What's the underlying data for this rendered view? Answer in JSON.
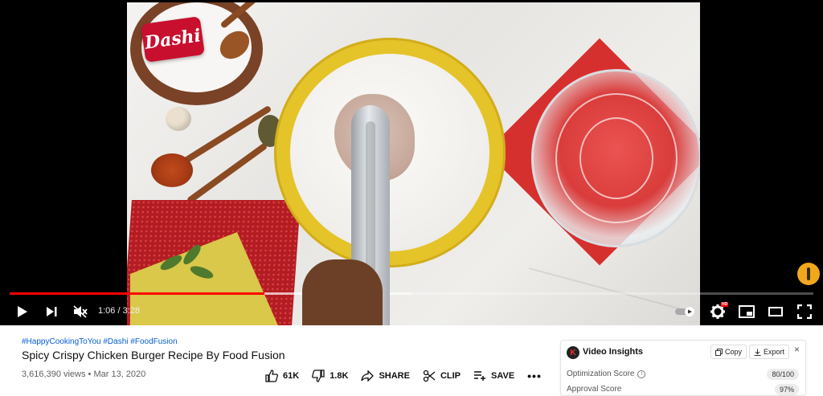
{
  "player": {
    "brand_logo_text": "Dashi",
    "current_time": "1:06",
    "duration": "3:28",
    "played_fraction": 0.317,
    "buffered_fraction": 0.5,
    "time_display": "1:06 / 3:28",
    "hd_badge": "HD",
    "controls": {
      "play_icon": "play-icon",
      "next_icon": "next-icon",
      "mute_icon": "volume-muted-icon",
      "autoplay_icon": "autoplay-toggle-icon",
      "settings_icon": "gear-icon",
      "miniplayer_icon": "miniplayer-icon",
      "theater_icon": "theater-mode-icon",
      "fullscreen_icon": "fullscreen-icon"
    }
  },
  "video": {
    "hashtags": "#HappyCookingToYou #Dashi #FoodFusion",
    "title": "Spicy Crispy Chicken Burger Recipe By Food Fusion",
    "views": "3,616,390 views",
    "separator": "•",
    "date": "Mar 13, 2020",
    "meta_line": "3,616,390 views • Mar 13, 2020"
  },
  "actions": {
    "like_count": "61K",
    "dislike_count": "1.8K",
    "share_label": "SHARE",
    "clip_label": "CLIP",
    "save_label": "SAVE",
    "more_label": "•••"
  },
  "insights": {
    "logo_letter": "K",
    "title": "Video Insights",
    "copy_label": "Copy",
    "export_label": "Export",
    "close_label": "×",
    "rows": [
      {
        "label": "Optimization Score",
        "value": "80/100"
      },
      {
        "label": "Approval Score",
        "value": "97%"
      }
    ]
  },
  "colors": {
    "progress_played": "#ff0000",
    "link_blue": "#065fd4",
    "brand_red": "#c8102e"
  }
}
